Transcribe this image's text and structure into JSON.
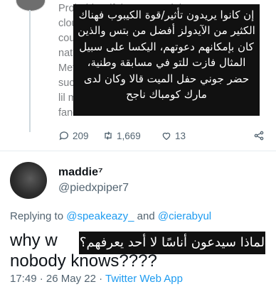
{
  "top_tweet": {
    "visible_text": "Probably... if they wanted the Kpop\ncloud...\ncoul...\nnat'...\nMet...\nsucc...\nlil m...\nfandoms tuned in.",
    "arabic_overlay": "إن كانوا يريدون تأثير/قوة الكيبوب فهناك الكثير من الآيدولز أفضل من بتس والذين كان بإمكانهم دعوتهم، اليكسا على سبيل المثال فازت للتو في مسابقة وطنية، حضر جوني حفل الميت قالا وكان لدى مارك كومباك ناجح",
    "replies": "209",
    "retweets": "1,669",
    "likes": "13"
  },
  "reply_tweet": {
    "display_name": "maddie⁷",
    "handle": "@piedxpiper7",
    "replying_prefix": "Replying to",
    "mention_1": "@speakeazy_",
    "replying_and": "and",
    "mention_2": "@cierabyul",
    "body": "why w\nnobody knows????",
    "arabic_overlay": "لماذا سيدعون أناسًا لا أحد يعرفهم؟",
    "time": "17:49",
    "date": "26 May 22",
    "source": "Twitter Web App"
  },
  "colors": {
    "link": "#1d9bf0",
    "muted": "#536471",
    "overlay": "#111111"
  },
  "icons": [
    "reply-icon",
    "retweet-icon",
    "like-icon",
    "share-icon"
  ]
}
